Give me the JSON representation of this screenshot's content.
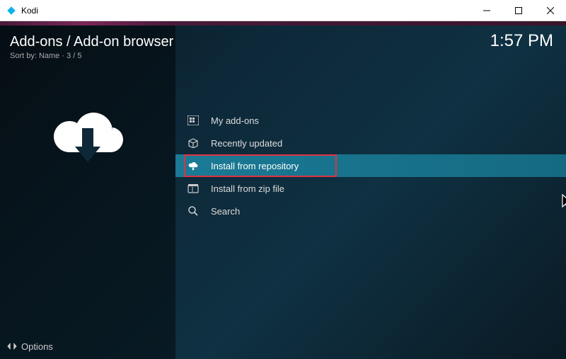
{
  "window": {
    "title": "Kodi"
  },
  "header": {
    "breadcrumb": "Add-ons / Add-on browser",
    "sort_label": "Sort by: Name",
    "position": "3 / 5"
  },
  "clock": "1:57 PM",
  "menu": {
    "items": [
      {
        "icon": "grid-icon",
        "label": "My add-ons"
      },
      {
        "icon": "box-icon",
        "label": "Recently updated"
      },
      {
        "icon": "cloud-down-icon",
        "label": "Install from repository",
        "selected": true,
        "highlighted": true
      },
      {
        "icon": "zip-icon",
        "label": "Install from zip file"
      },
      {
        "icon": "search-icon",
        "label": "Search"
      }
    ]
  },
  "footer": {
    "options_label": "Options"
  }
}
